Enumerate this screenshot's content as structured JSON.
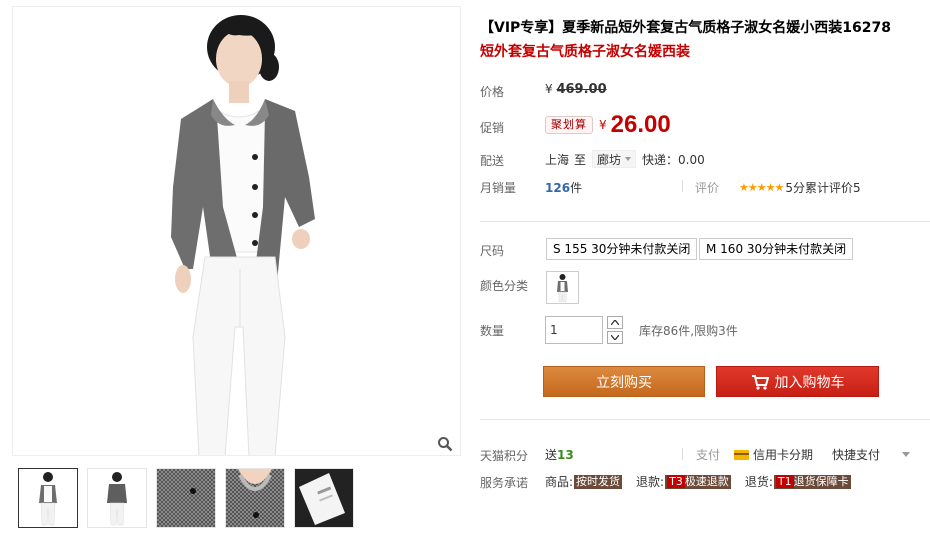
{
  "product": {
    "title": "【VIP专享】夏季新品短外套复古气质格子淑女名媛小西装16278",
    "subtitle": "短外套复古气质格子淑女名媛西装"
  },
  "price": {
    "label": "价格",
    "currency": "¥",
    "original": "469.00"
  },
  "promo": {
    "label": "促销",
    "tag": "聚划算",
    "currency": "¥",
    "price": "26.00"
  },
  "shipping": {
    "label": "配送",
    "from": "上海",
    "to_word": "至",
    "destination": "廊坊",
    "fee": "快递：0.00"
  },
  "sales": {
    "label": "月销量",
    "count": "126",
    "unit": "件",
    "review_label": "评价",
    "stars": "★★★★★",
    "review_text": "5分累计评价5"
  },
  "size": {
    "label": "尺码",
    "options": [
      "S 155 30分钟未付款关闭",
      "M 160 30分钟未付款关闭"
    ]
  },
  "color": {
    "label": "颜色分类"
  },
  "quantity": {
    "label": "数量",
    "value": "1",
    "stock": "库存86件,限购3件"
  },
  "actions": {
    "buy": "立刻购买",
    "cart": "加入购物车"
  },
  "points": {
    "label": "天猫积分",
    "text": "送",
    "value": "13"
  },
  "payment": {
    "label": "支付",
    "card": "信用卡分期",
    "quick": "快捷支付"
  },
  "promise": {
    "label": "服务承诺",
    "items": [
      {
        "prefix": "商品:",
        "badge": "按时发货",
        "code": ""
      },
      {
        "prefix": "退款:",
        "badge": "极速退款",
        "code": "T3"
      },
      {
        "prefix": "退货:",
        "badge": "退货保障卡",
        "code": "T1"
      }
    ]
  },
  "colors": {
    "promo_red": "#c40000",
    "buy_orange": "#d0772a",
    "cart_red": "#d42a1e",
    "link_blue": "#3366aa",
    "star_orange": "#ff9a00"
  }
}
